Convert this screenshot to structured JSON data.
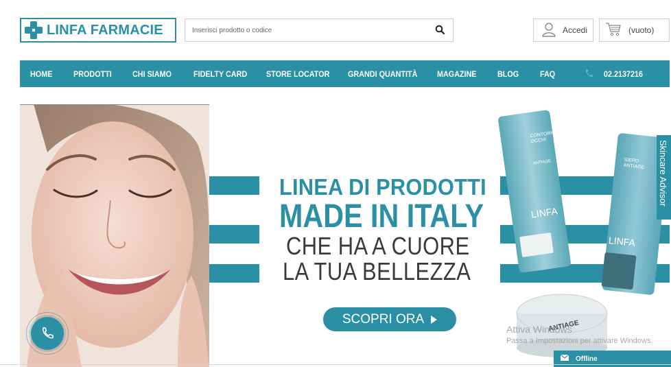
{
  "header": {
    "logo_text": "LINFA FARMACIE",
    "search": {
      "placeholder": "Inserisci prodotto o codice"
    },
    "login_label": "Accedi",
    "cart_label": "(vuoto)"
  },
  "nav": {
    "items": [
      {
        "label": "HOME"
      },
      {
        "label": "PRODOTTI"
      },
      {
        "label": "CHI SIAMO"
      },
      {
        "label": "FIDELTY CARD"
      },
      {
        "label": "STORE LOCATOR"
      },
      {
        "label": "GRANDI QUANTITÀ"
      },
      {
        "label": "MAGAZINE"
      },
      {
        "label": "BLOG"
      },
      {
        "label": "FAQ"
      }
    ],
    "phone": "02.2137216"
  },
  "hero": {
    "line1": "LINEA DI PRODOTTI",
    "line2": "MADE IN ITALY",
    "line3": "CHE HA A CUORE",
    "line4": "LA TUA BELLEZZA",
    "cta_label": "SCOPRI ORA",
    "products": {
      "tube1_label": "CONTORNO OCCHI",
      "tube1_sub": "ANTIAGE",
      "tube2_label": "SIERO ANTIAGE",
      "jar_label": "ANTIAGE",
      "brand": "LINFA"
    }
  },
  "side_tab": {
    "label": "Skincare Advisor"
  },
  "windows_watermark": {
    "title": "Attiva Windows",
    "subtitle": "Passa a Impostazioni per attivare Windows."
  },
  "chat": {
    "label": "Offline"
  },
  "colors": {
    "brand": "#2b8fa6",
    "text": "#3a3a3a"
  }
}
